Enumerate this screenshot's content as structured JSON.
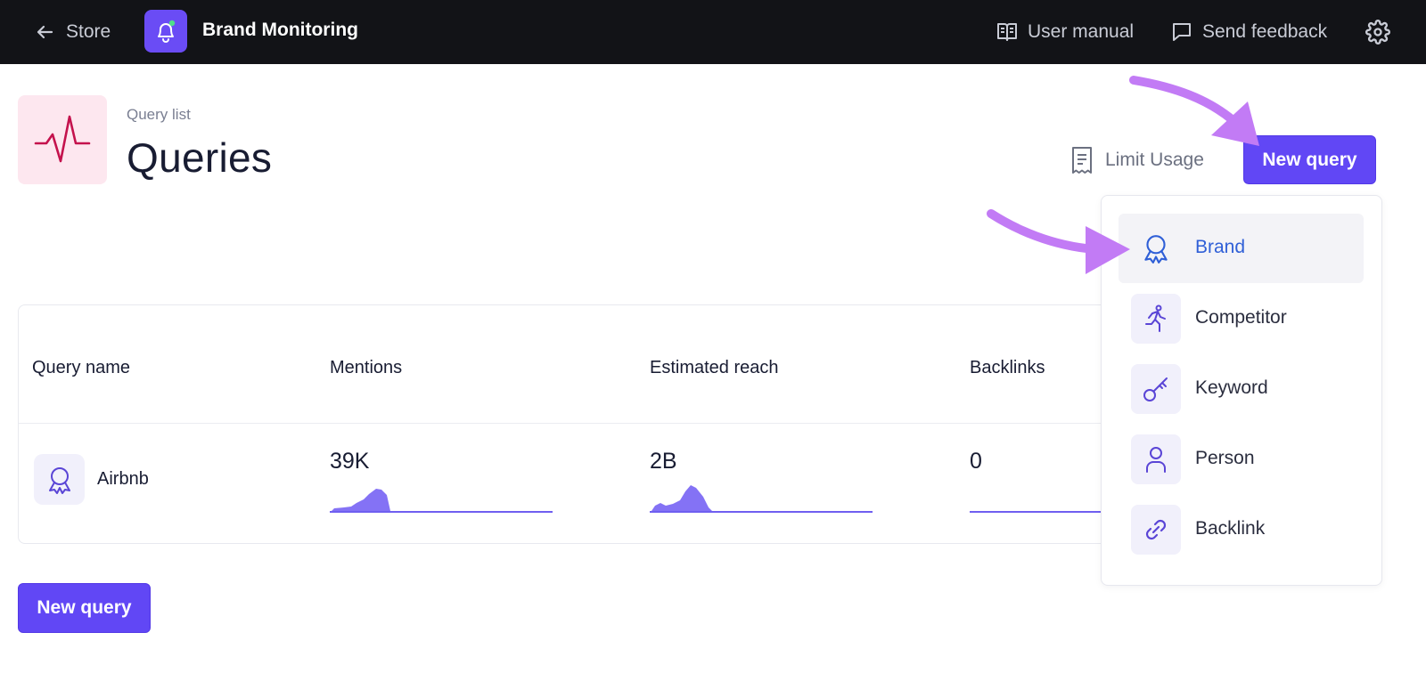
{
  "topbar": {
    "back_label": "Store",
    "app_title": "Brand Monitoring",
    "user_manual": "User manual",
    "send_feedback": "Send feedback"
  },
  "header": {
    "breadcrumb": "Query list",
    "title": "Queries",
    "limit_usage": "Limit Usage",
    "new_query": "New query"
  },
  "table": {
    "columns": [
      "Query name",
      "Mentions",
      "Estimated reach",
      "Backlinks"
    ],
    "rows": [
      {
        "name": "Airbnb",
        "mentions": "39K",
        "reach": "2B",
        "backlinks": "0"
      }
    ]
  },
  "dropdown": {
    "items": [
      {
        "label": "Brand",
        "icon": "award-ribbon-icon"
      },
      {
        "label": "Competitor",
        "icon": "running-person-icon"
      },
      {
        "label": "Keyword",
        "icon": "key-icon"
      },
      {
        "label": "Person",
        "icon": "person-icon"
      },
      {
        "label": "Backlink",
        "icon": "link-icon"
      }
    ]
  },
  "footer": {
    "new_query": "New query"
  },
  "colors": {
    "accent": "#6147f5",
    "topbar": "#121317",
    "highlight_arrow": "#c27bf5",
    "active_item_text": "#2f5fd7"
  }
}
